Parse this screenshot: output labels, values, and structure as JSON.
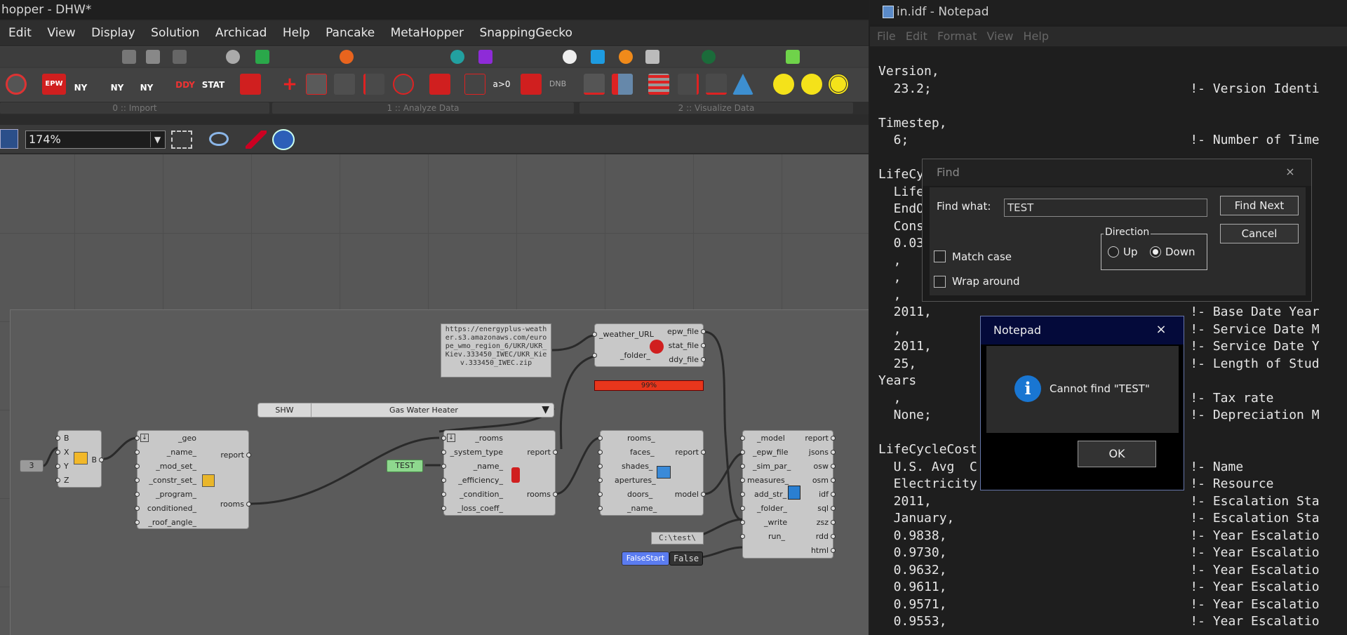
{
  "grasshopper": {
    "title": "hopper - DHW*",
    "menu": [
      "Edit",
      "View",
      "Display",
      "Solution",
      "Archicad",
      "Help",
      "Pancake",
      "MetaHopper",
      "SnappingGecko"
    ],
    "toolbar_groups": [
      "0 :: Import",
      "1 :: Analyze Data",
      "2 :: Visualize Data"
    ],
    "toolbar_labels": {
      "epw": "EPW",
      "ny1": "NY",
      "ny2": "NY",
      "ny3": "NY",
      "ddy": "DDY",
      "stat": "STAT",
      "dnb": "DNB",
      "a0": "a>0"
    },
    "zoom": "174%",
    "canvas": {
      "weather_url": "https://energyplus-weather.s3.amazonaws.com/europe_wmo_region_6/UKR/UKR_Kiev.333450_IWEC/UKR_Kiev.333450_IWEC.zip",
      "number_slider": "3",
      "point_component": {
        "inputs": [
          "B",
          "X",
          "Y",
          "Z"
        ],
        "output": "B"
      },
      "room_component": {
        "inputs": [
          "_geo",
          "_name_",
          "_mod_set_",
          "_constr_set_",
          "_program_",
          "conditioned_",
          "_roof_angle_"
        ],
        "outputs": [
          "report",
          "rooms"
        ]
      },
      "shw_list": {
        "label": "SHW",
        "value": "Gas Water Heater"
      },
      "shw_component": {
        "inputs": [
          "_rooms",
          "_system_type",
          "_name_",
          "_efficiency_",
          "_condition_",
          "_loss_coeff_"
        ],
        "outputs": [
          "report",
          "rooms"
        ]
      },
      "test_panel": "TEST",
      "weather_component": {
        "inputs": [
          "_weather_URL",
          "_folder_"
        ],
        "outputs": [
          "epw_file",
          "stat_file",
          "ddy_file"
        ],
        "progress": "99%"
      },
      "model_component": {
        "inputs": [
          "rooms_",
          "faces_",
          "shades_",
          "apertures_",
          "doors_",
          "_name_"
        ],
        "outputs": [
          "report",
          "model"
        ]
      },
      "run_component": {
        "inputs": [
          "_model",
          "_epw_file",
          "_sim_par_",
          "measures_",
          "add_str_",
          "_folder_",
          "_write",
          "run_"
        ],
        "outputs": [
          "report",
          "jsons",
          "osw",
          "osm",
          "idf",
          "sql",
          "zsz",
          "rdd",
          "html"
        ]
      },
      "folder_panel": "C:\\test\\",
      "toggle_label": "FalseStart",
      "toggle_value": "False"
    }
  },
  "notepad": {
    "title": "in.idf - Notepad",
    "menu": [
      "File",
      "Edit",
      "Format",
      "View",
      "Help"
    ],
    "lines": [
      "Version,",
      "  23.2;                                  !- Version Identi",
      "",
      "Timestep,",
      "  6;                                     !- Number of Time",
      "",
      "LifeCyc",
      "  Life",
      "  EndO                                              ng Co",
      "  Cons                                              Appr",
      "  0.03                                              ount",
      "  ,                                                iscou",
      "  ,",
      "  ,                                                 Mont",
      "  2011,                                  !- Base Date Year",
      "  ,                                      !- Service Date M",
      "  2011,                                  !- Service Date Y",
      "  25,                                    !- Length of Stud",
      "Years",
      "  ,                                      !- Tax rate",
      "  None;                                  !- Depreciation M",
      "",
      "LifeCycleCost",
      "  U.S. Avg  C                            !- Name",
      "  Electricity                            !- Resource",
      "  2011,                                  !- Escalation Sta",
      "  January,                               !- Escalation Sta",
      "  0.9838,                                !- Year Escalatio",
      "  0.9730,                                !- Year Escalatio",
      "  0.9632,                                !- Year Escalatio",
      "  0.9611,                                !- Year Escalatio",
      "  0.9571,                                !- Year Escalatio",
      "  0.9553,                                !- Year Escalatio"
    ]
  },
  "find_dialog": {
    "title": "Find",
    "close": "×",
    "find_what_label": "Find what:",
    "find_what_value": "TEST",
    "find_next": "Find Next",
    "cancel": "Cancel",
    "direction_label": "Direction",
    "up": "Up",
    "down": "Down",
    "match_case": "Match case",
    "wrap_around": "Wrap around"
  },
  "message_box": {
    "title": "Notepad",
    "close": "×",
    "icon": "i",
    "message": "Cannot find \"TEST\"",
    "ok": "OK"
  }
}
